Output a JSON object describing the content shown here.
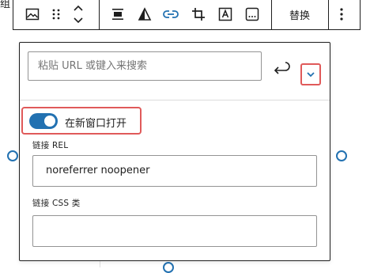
{
  "corner_text": "组",
  "toolbar": {
    "items": [
      {
        "name": "image-icon"
      },
      {
        "name": "drag-handle-icon"
      },
      {
        "name": "move-up-down-icon"
      },
      {
        "name": "align-icon"
      },
      {
        "name": "duotone-icon"
      },
      {
        "name": "link-icon"
      },
      {
        "name": "crop-icon"
      },
      {
        "name": "text-overlay-icon"
      },
      {
        "name": "more-inline-icon"
      }
    ],
    "replace_label": "替换",
    "options_icon": "vertical-ellipsis-icon",
    "active_color": "#2271b1"
  },
  "link_popover": {
    "url_placeholder": "粘贴 URL 或键入来搜索",
    "submit_icon": "enter-arrow-icon",
    "advanced_toggle_icon": "chevron-down-icon",
    "open_new_tab_label": "在新窗口打开",
    "open_new_tab_checked": true,
    "rel_label": "链接 REL",
    "rel_value": "noreferrer noopener",
    "css_label": "链接 CSS 类",
    "css_value": "",
    "highlight_color": "#e05a5a",
    "toggle_color": "#2271b1"
  }
}
